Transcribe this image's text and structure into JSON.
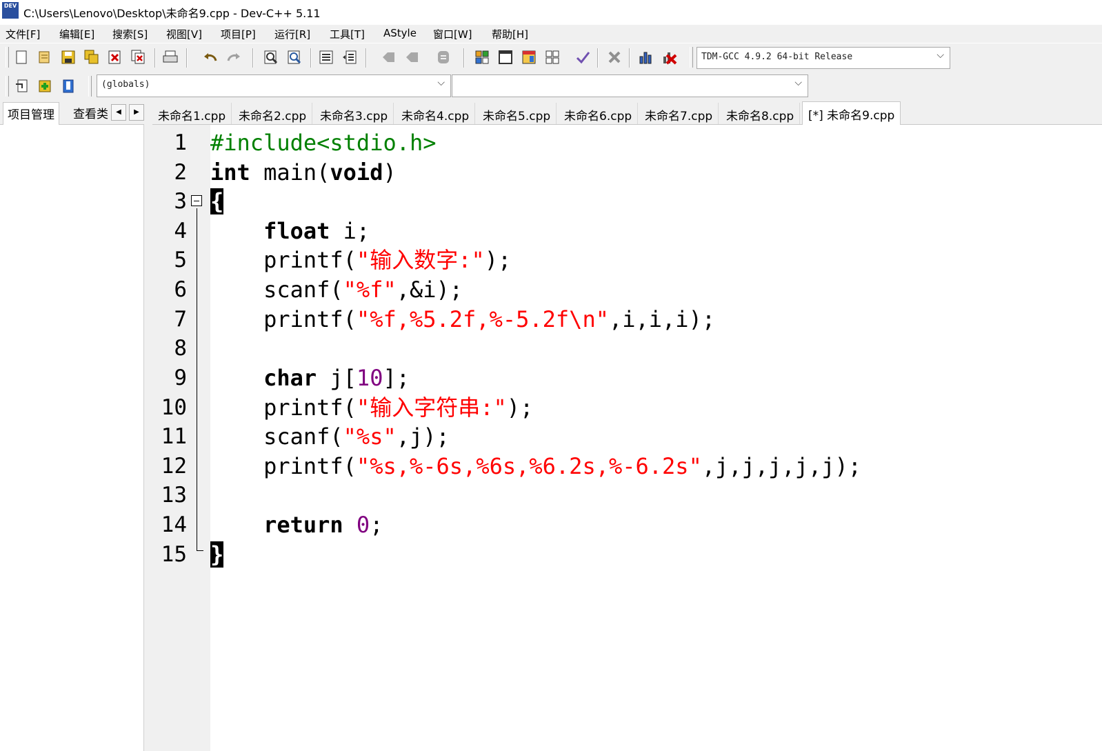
{
  "window": {
    "title": "C:\\Users\\Lenovo\\Desktop\\未命名9.cpp - Dev-C++ 5.11",
    "icon": "DEV"
  },
  "menu": [
    "文件[F]",
    "编辑[E]",
    "搜索[S]",
    "视图[V]",
    "项目[P]",
    "运行[R]",
    "工具[T]",
    "AStyle",
    "窗口[W]",
    "帮助[H]"
  ],
  "toolbar": {
    "compiler": "TDM-GCC 4.9.2 64-bit Release",
    "scope": "(globals)",
    "symbol": ""
  },
  "left_tabs": {
    "project": "项目管理",
    "view": "查看类"
  },
  "file_tabs": [
    "未命名1.cpp",
    "未命名2.cpp",
    "未命名3.cpp",
    "未命名4.cpp",
    "未命名5.cpp",
    "未命名6.cpp",
    "未命名7.cpp",
    "未命名8.cpp",
    "[*] 未命名9.cpp"
  ],
  "active_tab": 8,
  "line_numbers": [
    "1",
    "2",
    "3",
    "4",
    "5",
    "6",
    "7",
    "8",
    "9",
    "10",
    "11",
    "12",
    "13",
    "14",
    "15"
  ],
  "code": {
    "l1": "#include<stdio.h>",
    "l2": {
      "kw": "int",
      "mid": " main(",
      "kw2": "void",
      "end": ")"
    },
    "l3": "{",
    "l4": {
      "indent": "    ",
      "kw": "float",
      "rest": " i;"
    },
    "l5": {
      "pre": "    printf(",
      "str": "\"输入数字:\"",
      "post": ");"
    },
    "l6": {
      "pre": "    scanf(",
      "str": "\"%f\"",
      "post": ",&i);"
    },
    "l7": {
      "pre": "    printf(",
      "str": "\"%f,%5.2f,%-5.2f\\n\"",
      "post": ",i,i,i);"
    },
    "l9": {
      "indent": "    ",
      "kw": "char",
      "pre": " j[",
      "num": "10",
      "post": "];"
    },
    "l10": {
      "pre": "    printf(",
      "str": "\"输入字符串:\"",
      "post": ");"
    },
    "l11": {
      "pre": "    scanf(",
      "str": "\"%s\"",
      "post": ",j);"
    },
    "l12": {
      "pre": "    printf(",
      "str": "\"%s,%-6s,%6s,%6.2s,%-6.2s\"",
      "post": ",j,j,j,j,j);"
    },
    "l14": {
      "indent": "    ",
      "kw": "return",
      "sp": " ",
      "num": "0",
      "post": ";"
    },
    "l15": "}"
  },
  "colors": {
    "keyword": "#000000",
    "preprocessor": "#008000",
    "string": "#ff0000",
    "number": "#800080",
    "gutter": "#f0f0f0"
  }
}
